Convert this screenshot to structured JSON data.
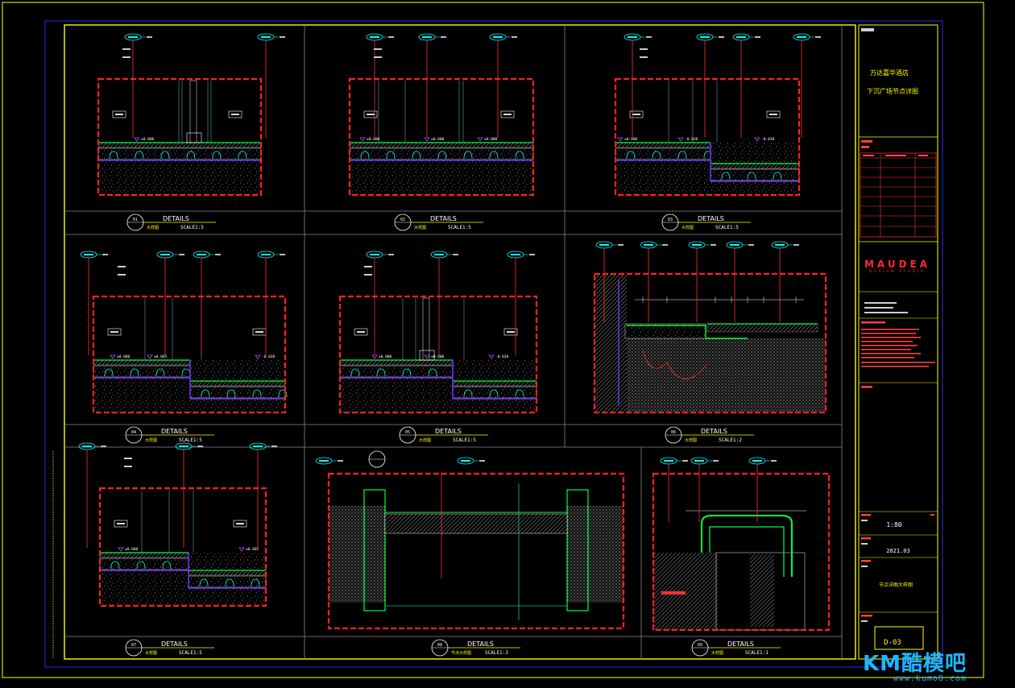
{
  "details": [
    {
      "num": "01",
      "title": "DETAILS",
      "sub": "大样图",
      "scale": "SCALE1:5"
    },
    {
      "num": "02",
      "title": "DETAILS",
      "sub": "大样图",
      "scale": "SCALE1:5"
    },
    {
      "num": "03",
      "title": "DETAILS",
      "sub": "大样图",
      "scale": "SCALE1:5"
    },
    {
      "num": "04",
      "title": "DETAILS",
      "sub": "大样图",
      "scale": "SCALE1:5"
    },
    {
      "num": "05",
      "title": "DETAILS",
      "sub": "大样图",
      "scale": "SCALE1:5"
    },
    {
      "num": "06",
      "title": "DETAILS",
      "sub": "大样图",
      "scale": "SCALE1:2"
    },
    {
      "num": "07",
      "title": "DETAILS",
      "sub": "大样图",
      "scale": "SCALE1:5"
    },
    {
      "num": "08",
      "title": "DETAILS",
      "sub": "节点大样图",
      "scale": "SCALE1:3"
    },
    {
      "num": "09",
      "title": "DETAILS",
      "sub": "大样图",
      "scale": "SCALE1:1"
    }
  ],
  "level_tags": [
    "±0.000",
    "±0.000",
    "-0.020",
    "±0.005",
    "±0.000",
    "-0.020"
  ],
  "title_block": {
    "project_line1": "万达嘉华酒店",
    "project_line2": "下沉广场节点详图",
    "brand": "MAUDEA",
    "brand_sub": "DESIGN STUDIO",
    "scale": "1:80",
    "date": "2021.03",
    "drawing_name": "节点详图大样图",
    "drawing_no": "D-03"
  },
  "watermark": {
    "text": "KM酷模吧",
    "url": "www.kumo8.com"
  },
  "colors": {
    "background": "#000000",
    "frame": "#ffff00",
    "outer_frame": "#2020ff",
    "cut_line": "#ff2020",
    "leader": "#ff3030",
    "tag": "#00ffff",
    "finish": "#00ff40",
    "waterproof": "#7030ff",
    "level_mark": "#c040ff"
  }
}
